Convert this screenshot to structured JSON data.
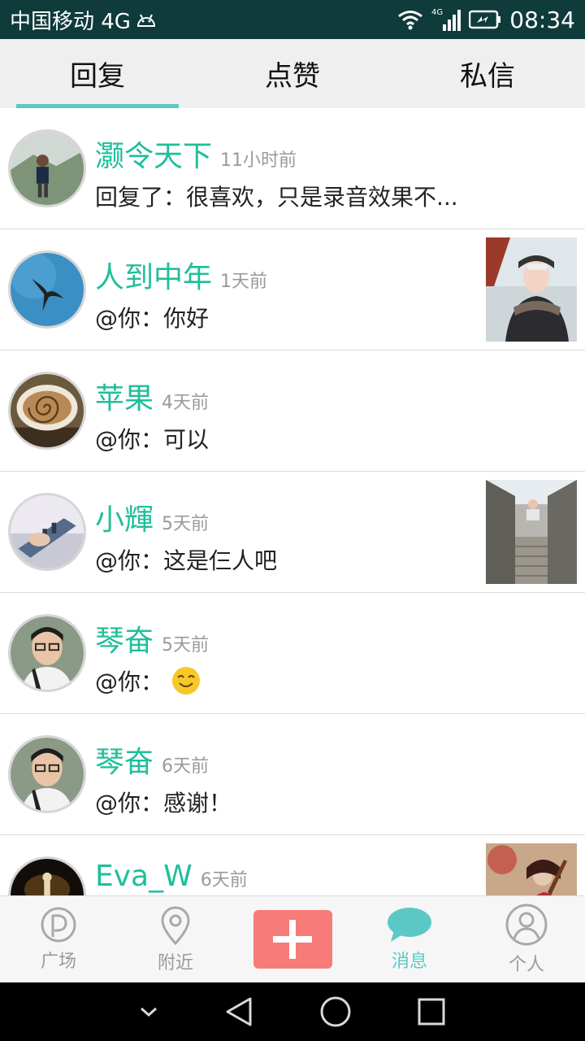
{
  "status_bar": {
    "carrier": "中国移动 4G",
    "network_badge": "4G",
    "time": "08:34",
    "icons": [
      "android-icon",
      "wifi-icon",
      "signal-icon",
      "battery-icon"
    ]
  },
  "tabs": [
    {
      "label": "回复",
      "active": true
    },
    {
      "label": "点赞",
      "active": false
    },
    {
      "label": "私信",
      "active": false
    }
  ],
  "messages": [
    {
      "name": "灏令天下",
      "time": "11小时前",
      "text": "回复了：很喜欢，只是录音效果不...",
      "has_thumb": false
    },
    {
      "name": "人到中年",
      "time": "1天前",
      "text": "@你：你好",
      "has_thumb": true
    },
    {
      "name": "苹果",
      "time": "4天前",
      "text": "@你：可以",
      "has_thumb": false
    },
    {
      "name": "小輝",
      "time": "5天前",
      "text": "@你：这是仨人吧",
      "has_thumb": true
    },
    {
      "name": "琴奋",
      "time": "5天前",
      "text": "@你：",
      "emoji": "smiling-face-emoji",
      "has_thumb": false
    },
    {
      "name": "琴奋",
      "time": "6天前",
      "text": "@你：感谢！",
      "has_thumb": false
    },
    {
      "name": "Eva_W",
      "time": "6天前",
      "text": "",
      "has_thumb": true
    }
  ],
  "bottom_nav": {
    "items": [
      {
        "label": "广场",
        "icon": "square-p-icon",
        "active": false
      },
      {
        "label": "附近",
        "icon": "location-pin-icon",
        "active": false
      },
      {
        "label": "",
        "icon": "plus-icon",
        "active": false
      },
      {
        "label": "消息",
        "icon": "message-bubble-icon",
        "active": true
      },
      {
        "label": "个人",
        "icon": "person-icon",
        "active": false
      }
    ],
    "accent_color": "#5bc8c6",
    "add_button_color": "#f77b79"
  },
  "system_nav": {
    "icons": [
      "chevron-down-icon",
      "back-triangle-icon",
      "home-circle-icon",
      "recents-square-icon"
    ]
  },
  "colors": {
    "name": "#1fbf9a",
    "status_bar": "#0f3b3a",
    "tab_underline": "#5bc8c6"
  }
}
